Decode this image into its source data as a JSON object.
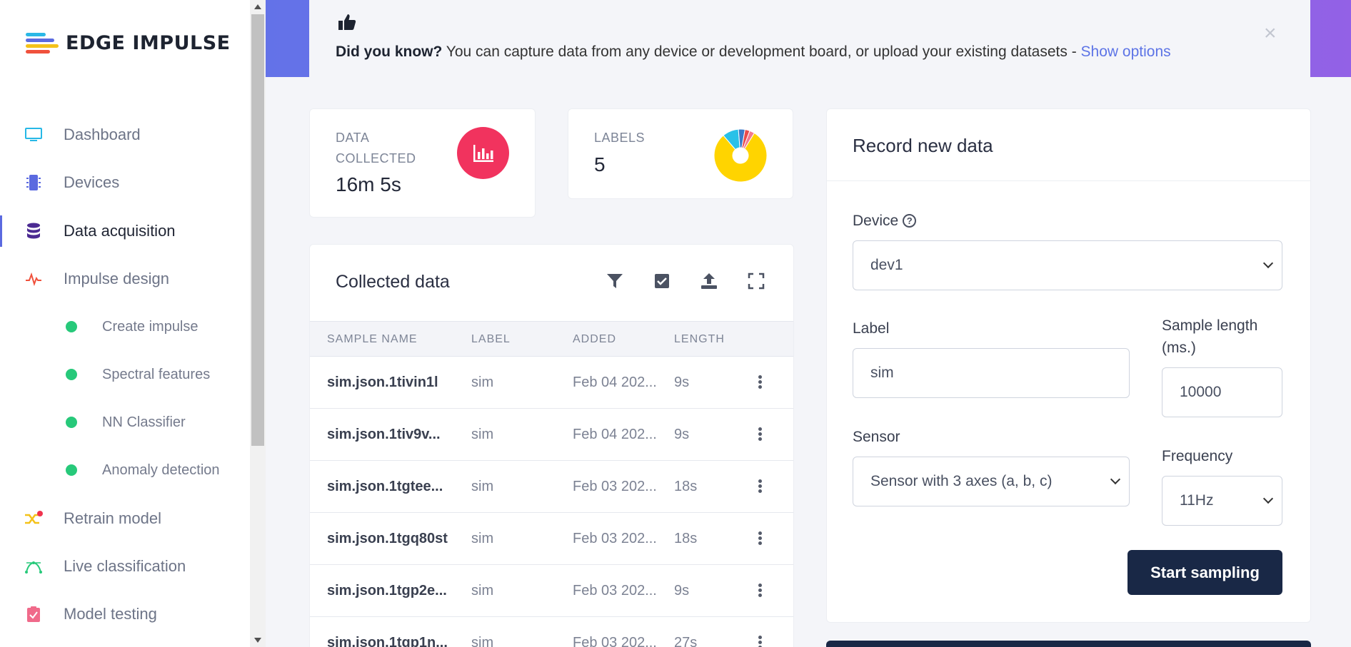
{
  "brand": {
    "name": "EDGE IMPULSE",
    "colors": [
      "#2ab8e6",
      "#f4c21a",
      "#5b6ae0",
      "#f0513c",
      "#27c97a"
    ]
  },
  "sidebar": {
    "items": [
      {
        "label": "Dashboard",
        "icon": "monitor-icon",
        "color": "#27b8e6"
      },
      {
        "label": "Devices",
        "icon": "chip-icon",
        "color": "#5b6ae0"
      },
      {
        "label": "Data acquisition",
        "icon": "database-icon",
        "color": "#4b2a92",
        "active": true
      },
      {
        "label": "Impulse design",
        "icon": "pulse-icon",
        "color": "#f0513c"
      }
    ],
    "subitems": [
      {
        "label": "Create impulse"
      },
      {
        "label": "Spectral features"
      },
      {
        "label": "NN Classifier"
      },
      {
        "label": "Anomaly detection"
      }
    ],
    "items2": [
      {
        "label": "Retrain model",
        "icon": "shuffle-icon",
        "color": "#f4c21a"
      },
      {
        "label": "Live classification",
        "icon": "curve-icon",
        "color": "#27c97a"
      },
      {
        "label": "Model testing",
        "icon": "clipboard-check-icon",
        "color": "#f06a8a"
      }
    ]
  },
  "banner": {
    "bold": "Did you know?",
    "text": " You can capture data from any device or development board, or upload your existing datasets - ",
    "link": "Show options",
    "close": "×"
  },
  "stats": {
    "data_collected": {
      "label": "DATA COLLECTED",
      "value": "16m 5s",
      "icon_color": "#f1335e"
    },
    "labels": {
      "label": "LABELS",
      "value": "5"
    }
  },
  "labels_pie": {
    "type": "pie",
    "values": [
      80,
      10,
      4,
      3,
      3
    ],
    "colors": [
      "#ffd400",
      "#29c1e8",
      "#3a7ac9",
      "#e94b4b",
      "#f27a8e"
    ]
  },
  "collected": {
    "title": "Collected data",
    "tools": [
      "filter-icon",
      "check-square-icon",
      "upload-icon",
      "expand-icon"
    ],
    "columns": [
      "SAMPLE NAME",
      "LABEL",
      "ADDED",
      "LENGTH"
    ],
    "rows": [
      {
        "name": "sim.json.1tivin1l",
        "label": "sim",
        "added": "Feb 04 202...",
        "length": "9s"
      },
      {
        "name": "sim.json.1tiv9v...",
        "label": "sim",
        "added": "Feb 04 202...",
        "length": "9s"
      },
      {
        "name": "sim.json.1tgtee...",
        "label": "sim",
        "added": "Feb 03 202...",
        "length": "18s"
      },
      {
        "name": "sim.json.1tgq80st",
        "label": "sim",
        "added": "Feb 03 202...",
        "length": "18s"
      },
      {
        "name": "sim.json.1tgp2e...",
        "label": "sim",
        "added": "Feb 03 202...",
        "length": "9s"
      },
      {
        "name": "sim.json.1tgp1n...",
        "label": "sim",
        "added": "Feb 03 202...",
        "length": "27s"
      }
    ]
  },
  "record": {
    "title": "Record new data",
    "device_label": "Device",
    "device_value": "dev1",
    "label_label": "Label",
    "label_value": "sim",
    "sample_length_label_1": "Sample length",
    "sample_length_label_2": "(ms.)",
    "sample_length_value": "10000",
    "sensor_label": "Sensor",
    "sensor_value": "Sensor with 3 axes (a, b, c)",
    "frequency_label": "Frequency",
    "frequency_value": "11Hz",
    "start_button": "Start sampling"
  }
}
